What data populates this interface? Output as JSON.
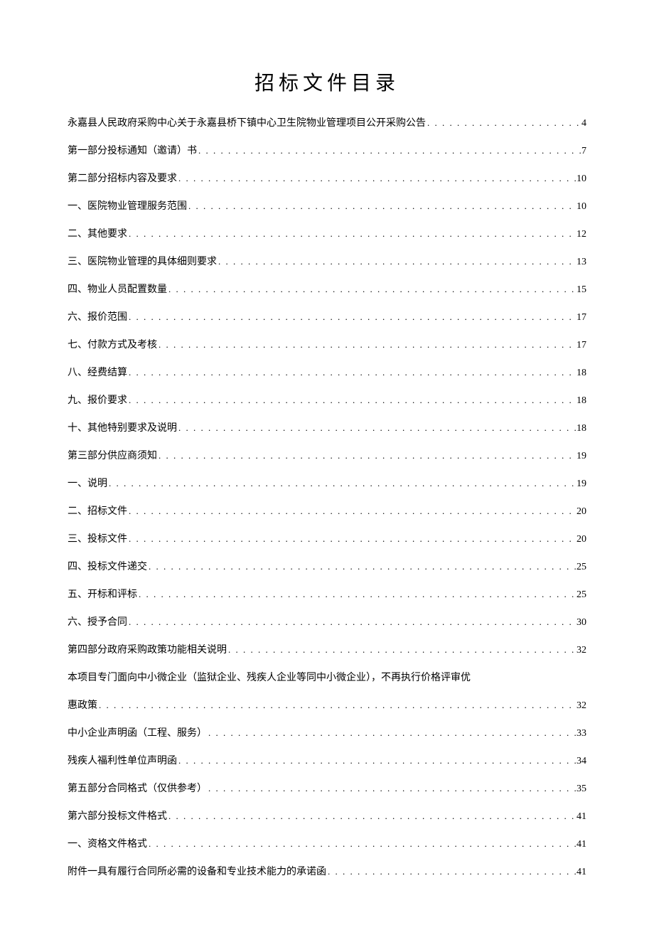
{
  "title": "招标文件目录",
  "toc": [
    {
      "label": "永嘉县人民政府采购中心关于永嘉县桥下镇中心卫生院物业管理项目公开采购公告",
      "page": "4"
    },
    {
      "label": "第一部分投标通知（邀请）书",
      "page": "7"
    },
    {
      "label": "第二部分招标内容及要求",
      "page": "10"
    },
    {
      "label": "一、医院物业管理服务范围",
      "page": "10"
    },
    {
      "label": "二、其他要求",
      "page": "12"
    },
    {
      "label": "三、医院物业管理的具体细则要求",
      "page": "13"
    },
    {
      "label": "四、物业人员配置数量",
      "page": "15"
    },
    {
      "label": "六、报价范围",
      "page": "17"
    },
    {
      "label": "七、付款方式及考核",
      "page": "17"
    },
    {
      "label": "八、经费结算",
      "page": "18"
    },
    {
      "label": "九、报价要求",
      "page": "18"
    },
    {
      "label": "十、其他特别要求及说明",
      "page": "18"
    },
    {
      "label": "第三部分供应商须知",
      "page": "19"
    },
    {
      "label": "一、说明",
      "page": "19"
    },
    {
      "label": "二、招标文件",
      "page": "20"
    },
    {
      "label": "三、投标文件",
      "page": "20"
    },
    {
      "label": "四、投标文件递交",
      "page": "25"
    },
    {
      "label": "五、开标和评标",
      "page": "25"
    },
    {
      "label": "六、授予合同",
      "page": "30"
    },
    {
      "label": "第四部分政府采购政策功能相关说明",
      "page": "32"
    },
    {
      "label": "本项目专门面向中小微企业（监狱企业、残疾人企业等同中小微企业），不再执行价格评审优",
      "page": "",
      "nopage": true
    },
    {
      "label": "惠政策",
      "page": "32"
    },
    {
      "label": "中小企业声明函（工程、服务）",
      "page": "33"
    },
    {
      "label": "残疾人福利性单位声明函",
      "page": "34"
    },
    {
      "label": "第五部分合同格式（仅供参考）",
      "page": "35"
    },
    {
      "label": "第六部分投标文件格式",
      "page": "41"
    },
    {
      "label": "一、资格文件格式",
      "page": "41"
    },
    {
      "label": "附件一具有履行合同所必需的设备和专业技术能力的承诺函",
      "page": "41"
    }
  ]
}
